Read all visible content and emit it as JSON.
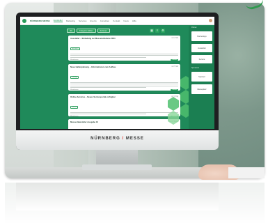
{
  "monitor": {
    "brand_left": "NÜRNBERG",
    "brand_right": "MESSE"
  },
  "app": {
    "title": "NÜRNBERG MESSE",
    "nav": [
      "Aussteller",
      "Marketing",
      "Services",
      "Events",
      "Anmelden",
      "Kontakt",
      "News",
      "Hilfe"
    ]
  },
  "toolbar": {
    "chips": [
      "Alle",
      "Kategorie wählen",
      "Sortieren"
    ],
    "icons": [
      "grid-icon",
      "list-icon"
    ]
  },
  "cards": [
    {
      "title": "Aussteller – Einladung zur Messeteilnahme 2024",
      "meta": "vor 2 Std",
      "tag": "Aussteller",
      "foot": "Weiterlesen",
      "btn": "Details"
    },
    {
      "title": "Neue Hallenplanung – Informationen zum Aufbau",
      "meta": "vor 5 Std",
      "tag": "Planung",
      "foot": "Weiterlesen",
      "btn": "Details"
    },
    {
      "title": "Online-Services – Neues Serviceportal verfügbar",
      "meta": "vor 1 Tag",
      "tag": "Service",
      "foot": "Weiterlesen",
      "btn": "Details"
    },
    {
      "title": "Messe-Newsletter Ausgabe 12",
      "meta": "vor 2 Tagen",
      "tag": "",
      "foot": "",
      "btn": ""
    }
  ],
  "sidebar": {
    "sections": [
      {
        "label": "Partner",
        "card": "Partnerlogo"
      },
      {
        "label": "",
        "card": "Aussteller"
      },
      {
        "label": "",
        "card": "Service"
      },
      {
        "label": "Sponsoren",
        "card": "Sponsor"
      },
      {
        "label": "",
        "card": "Messeplatz"
      }
    ]
  },
  "colors": {
    "accent": "#2aa45f",
    "screen_bg": "#1f8a5a",
    "brand_slash": "#e2392b"
  }
}
